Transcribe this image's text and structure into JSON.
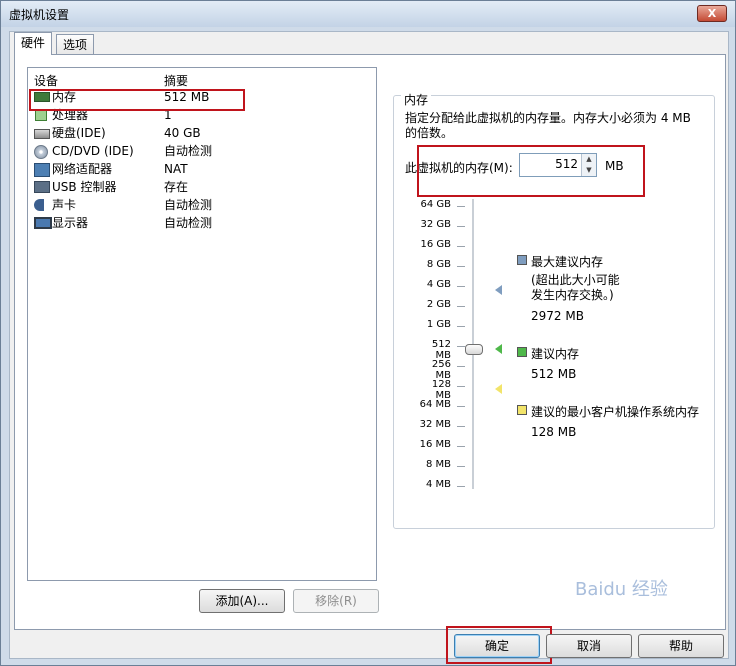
{
  "window": {
    "title": "虚拟机设置",
    "close_label": "X"
  },
  "tabs": [
    {
      "label": "硬件"
    },
    {
      "label": "选项"
    }
  ],
  "devices": {
    "header_device": "设备",
    "header_summary": "摘要",
    "items": [
      {
        "name": "内存",
        "summary": "512 MB",
        "icon": "memory-icon"
      },
      {
        "name": "处理器",
        "summary": "1",
        "icon": "processor-icon"
      },
      {
        "name": "硬盘(IDE)",
        "summary": "40 GB",
        "icon": "hard-disk-icon"
      },
      {
        "name": "CD/DVD (IDE)",
        "summary": "自动检测",
        "icon": "cd-dvd-icon"
      },
      {
        "name": "网络适配器",
        "summary": "NAT",
        "icon": "network-adapter-icon"
      },
      {
        "name": "USB 控制器",
        "summary": "存在",
        "icon": "usb-icon"
      },
      {
        "name": "声卡",
        "summary": "自动检测",
        "icon": "sound-card-icon"
      },
      {
        "name": "显示器",
        "summary": "自动检测",
        "icon": "display-icon"
      }
    ],
    "add_label": "添加(A)...",
    "remove_label": "移除(R)"
  },
  "memory": {
    "group_label": "内存",
    "description": "指定分配给此虚拟机的内存量。内存大小必须为 4 MB 的倍数。",
    "field_label": "此虚拟机的内存(M):",
    "value": "512",
    "unit": "MB",
    "scale": [
      "64 GB",
      "32 GB",
      "16 GB",
      "8 GB",
      "4 GB",
      "2 GB",
      "1 GB",
      "512 MB",
      "256 MB",
      "128 MB",
      "64 MB",
      "32 MB",
      "16 MB",
      "8 MB",
      "4 MB"
    ],
    "legend": {
      "max_title": "最大建议内存",
      "max_note": "(超出此大小可能\n发生内存交换。)",
      "max_value": "2972 MB",
      "rec_title": "建议内存",
      "rec_value": "512 MB",
      "min_title": "建议的最小客户机操作系统内存",
      "min_value": "128 MB"
    },
    "colors": {
      "max": "#7f9dbf",
      "rec": "#4fb84a",
      "min": "#f2e46a"
    }
  },
  "footer": {
    "ok_label": "确定",
    "cancel_label": "取消",
    "help_label": "帮助"
  },
  "watermark": "Baidu 经验"
}
